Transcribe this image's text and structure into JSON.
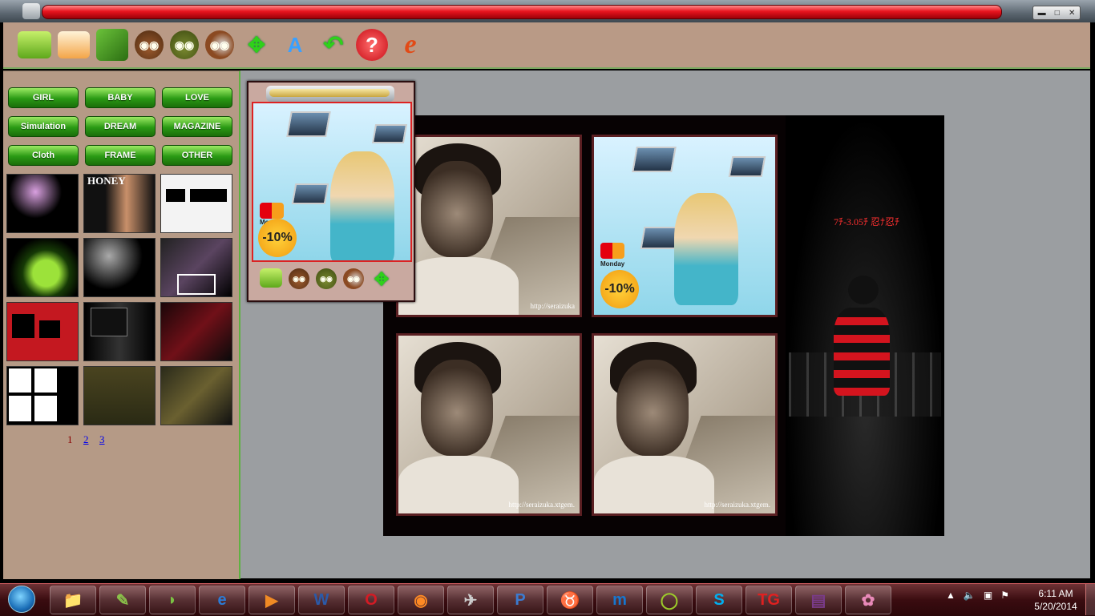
{
  "window": {
    "controls": {
      "minimize": "▬",
      "maximize": "□",
      "close": "✕"
    }
  },
  "toolbar": {
    "tools": [
      {
        "icon": "folder-open-icon"
      },
      {
        "icon": "print-icon"
      },
      {
        "icon": "image-edit-icon"
      },
      {
        "icon": "owl-effect-icon"
      },
      {
        "icon": "owl-effect-2-icon"
      },
      {
        "icon": "owl-effect-3-icon"
      },
      {
        "icon": "move-arrows-icon"
      },
      {
        "icon": "text-icon"
      },
      {
        "icon": "undo-icon"
      },
      {
        "icon": "help-icon"
      },
      {
        "icon": "internet-explorer-icon"
      }
    ]
  },
  "categories": [
    {
      "label": "GIRL"
    },
    {
      "label": "BABY"
    },
    {
      "label": "LOVE"
    },
    {
      "label": "Simulation"
    },
    {
      "label": "DREAM"
    },
    {
      "label": "MAGAZINE"
    },
    {
      "label": "Cloth"
    },
    {
      "label": "FRAME"
    },
    {
      "label": "OTHER"
    }
  ],
  "thumb_texts": {
    "honey": "HONEY"
  },
  "pagination": {
    "pages": [
      "1",
      "2",
      "3"
    ],
    "current": "1"
  },
  "collage": {
    "watermark": "http://seraizuka.xtgem.",
    "watermark_top": "http://seraizuka",
    "ad": {
      "discount": "-10%",
      "card_label": "Monday"
    },
    "right_text": "7ﾁ-3.05ﾁ 忍ﾅ忍ﾁ"
  },
  "palette": {
    "card_label": "Monday",
    "discount": "-10%"
  },
  "taskbar": {
    "apps": [
      {
        "name": "explorer",
        "glyph": "📁"
      },
      {
        "name": "paint",
        "glyph": "✎"
      },
      {
        "name": "app-green",
        "glyph": "◗"
      },
      {
        "name": "internet-explorer",
        "glyph": "e"
      },
      {
        "name": "media-player",
        "glyph": "▶"
      },
      {
        "name": "word",
        "glyph": "W"
      },
      {
        "name": "opera",
        "glyph": "O"
      },
      {
        "name": "firefox",
        "glyph": "◉"
      },
      {
        "name": "app-bird",
        "glyph": "✈"
      },
      {
        "name": "app-p",
        "glyph": "P"
      },
      {
        "name": "app-cow",
        "glyph": "♉"
      },
      {
        "name": "maxthon",
        "glyph": "m"
      },
      {
        "name": "app-o",
        "glyph": "◯"
      },
      {
        "name": "skype",
        "glyph": "S"
      },
      {
        "name": "app-tg",
        "glyph": "TG"
      },
      {
        "name": "winrar",
        "glyph": "▤"
      },
      {
        "name": "photo-app",
        "glyph": "✿"
      }
    ],
    "clock": {
      "time": "6:11 AM",
      "date": "5/20/2014"
    }
  },
  "colors": {
    "accent_red": "#e8141e",
    "panel_bg": "#b59a86",
    "button_green": "#2a9a14",
    "canvas_gray": "#9b9ea1",
    "taskbar": "#3a0c10"
  }
}
